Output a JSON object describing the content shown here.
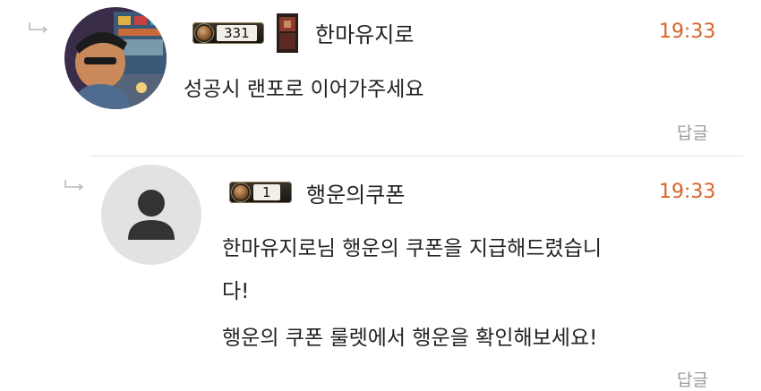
{
  "comments": [
    {
      "level": "331",
      "nickname": "한마유지로",
      "time": "19:33",
      "lines": [
        "성공시 랜포로 이어가주세요"
      ],
      "reply_label": "답글"
    },
    {
      "level": "1",
      "nickname": "행운의쿠폰",
      "time": "19:33",
      "lines": [
        "한마유지로님 행운의 쿠폰을 지급해드렸습니",
        "다!",
        "행운의 쿠폰 룰렛에서 행운을 확인해보세요!"
      ],
      "reply_label": "답글"
    }
  ],
  "colors": {
    "time": "#d8642a",
    "muted": "#9a9a9a"
  }
}
